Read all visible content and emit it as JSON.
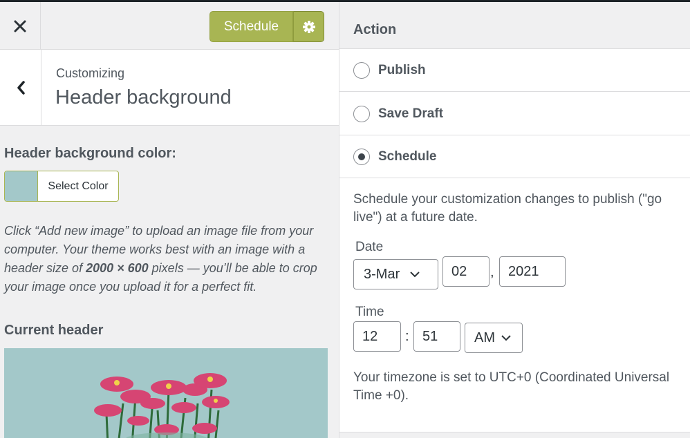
{
  "header": {
    "schedule_label": "Schedule"
  },
  "section": {
    "subtitle": "Customizing",
    "title": "Header background"
  },
  "controls": {
    "bg_color_label": "Header background color:",
    "select_color_label": "Select Color",
    "swatch_color": "#a3c8c9",
    "description_part1": "Click “Add new image” to upload an image file from your computer. Your theme works best with an image with a header size of ",
    "description_bold": "2000 × 600",
    "description_part2": " pixels — you’ll be able to crop your image once you upload it for a perfect fit.",
    "current_header_label": "Current header"
  },
  "action": {
    "title": "Action",
    "options": [
      {
        "label": "Publish",
        "checked": false
      },
      {
        "label": "Save Draft",
        "checked": false
      },
      {
        "label": "Schedule",
        "checked": true
      }
    ],
    "schedule_description": "Schedule your customization changes to publish (\"go live\") at a future date.",
    "date_label": "Date",
    "month": "3-Mar",
    "day": "02",
    "year": "2021",
    "time_label": "Time",
    "hour": "12",
    "minute": "51",
    "meridiem": "AM",
    "timezone_text": "Your timezone is set to UTC+0 (Coordinated Universal Time +0)."
  },
  "colors": {
    "accent": "#a8b553",
    "image_bg": "#a3c8c9"
  }
}
